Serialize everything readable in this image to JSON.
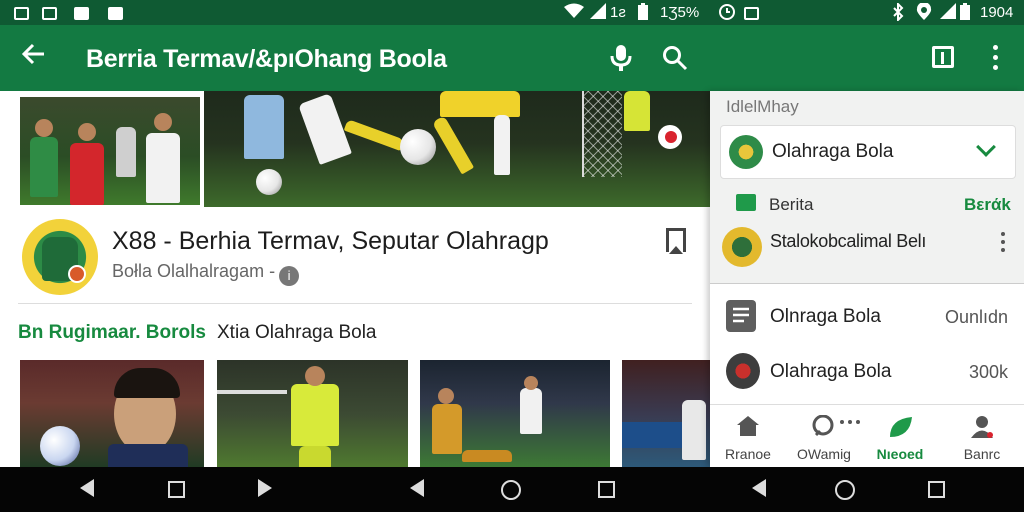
{
  "status_bar": {
    "left_icons": [
      "gallery-icon",
      "no-sim-icon",
      "image-icon",
      "edit-icon"
    ],
    "signal_label": "1ƨ",
    "battery_text": "1Ʒ5%",
    "right_time": "1904"
  },
  "app_bar": {
    "back_icon": "back-arrow-icon",
    "title": "Berria Termav/&pıOhang Boola",
    "actions": [
      "mic-icon",
      "search-icon"
    ]
  },
  "right_bar": {
    "actions": [
      "tab-view-icon",
      "more-vert-icon"
    ]
  },
  "channel": {
    "title": "X88 - Berhia Termav, Seputar Olahragp",
    "subtitle": "Bołla  Olalhalragam -"
  },
  "section": {
    "green_label": "Bn Rugimaar. Borols",
    "title": "Xtia Olahraga Bola"
  },
  "right_panel": {
    "heading": "IdlelMhay",
    "card_label": "Olahraga Bola",
    "row2": {
      "label": "Berita",
      "action": "Bεrάk"
    },
    "row3": {
      "label": "Stalokobcalimal Belı"
    },
    "list": [
      {
        "label": "Olnraga Bola",
        "value": "Ounlıdn",
        "icon": "document-icon"
      },
      {
        "label": "Olahraga Bola",
        "value": "300k",
        "icon": "shield-icon"
      }
    ],
    "bottom_nav": [
      {
        "label": "Rranoe",
        "icon": "home-icon",
        "active": false
      },
      {
        "label": "OWamig",
        "icon": "chat-icon",
        "active": false
      },
      {
        "label": "Nıeoed",
        "icon": "leaf-icon",
        "active": true
      },
      {
        "label": "Banrc",
        "icon": "person-icon",
        "active": false
      }
    ]
  },
  "colors": {
    "status_bar": "#0f5a33",
    "app_bar": "#137a42",
    "accent": "#178a3f"
  }
}
